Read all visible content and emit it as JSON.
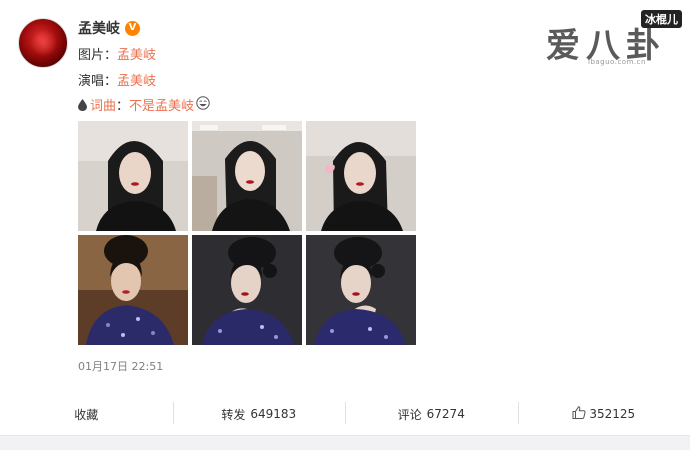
{
  "post": {
    "username": "孟美岐",
    "verified_badge": "V",
    "lines": [
      {
        "label": "图片：",
        "value": "孟美岐"
      },
      {
        "label": "演唱：",
        "value": "孟美岐"
      },
      {
        "label": "词曲：",
        "value": "不是孟美岐"
      }
    ],
    "line3_prefix_label": "词曲",
    "line3_colon": "：",
    "timestamp": "01月17日 22:51",
    "photos": [
      {
        "id": "photo-1",
        "theme": "light-black-hair"
      },
      {
        "id": "photo-2",
        "theme": "light-black-hair"
      },
      {
        "id": "photo-3",
        "theme": "light-black-hair-heart"
      },
      {
        "id": "photo-4",
        "theme": "warm-sequin"
      },
      {
        "id": "photo-5",
        "theme": "dark-sequin"
      },
      {
        "id": "photo-6",
        "theme": "dark-sequin"
      }
    ]
  },
  "actions": {
    "collect": {
      "label": "收藏"
    },
    "repost": {
      "label": "转发",
      "count": "649183"
    },
    "comment": {
      "label": "评论",
      "count": "67274"
    },
    "like": {
      "count": "352125"
    }
  },
  "watermark": {
    "main": "爱八卦",
    "tag": "冰棍儿",
    "url": "ibaguo.com.cn"
  },
  "colors": {
    "link": "#eb7350",
    "verified": "#ff8200",
    "timestamp": "#808080"
  },
  "icons": [
    "verified-icon",
    "drop-icon",
    "smile-emoji-icon",
    "thumb-up-icon"
  ]
}
